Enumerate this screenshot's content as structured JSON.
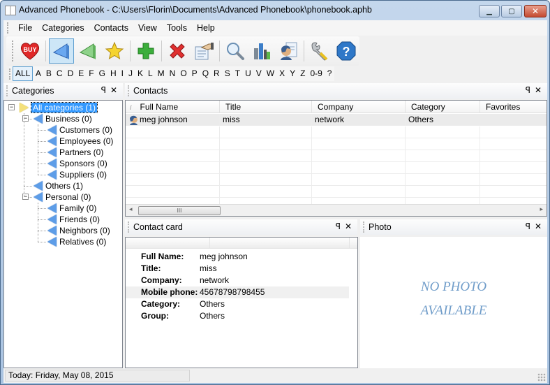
{
  "window": {
    "title": "Advanced Phonebook - C:\\Users\\Florin\\Documents\\Advanced Phonebook\\phonebook.aphb",
    "minimize": "▁",
    "maximize": "▢",
    "close": "✕"
  },
  "menu": [
    "File",
    "Categories",
    "Contacts",
    "View",
    "Tools",
    "Help"
  ],
  "toolbar": {
    "buttons": [
      {
        "name": "buy-button",
        "icon": "buy-heart-icon"
      },
      {
        "name": "back-button",
        "icon": "blue-triangle-icon",
        "active": true
      },
      {
        "name": "green-triangle-button",
        "icon": "green-triangle-icon"
      },
      {
        "name": "favorites-button",
        "icon": "star-icon"
      },
      {
        "name": "add-contact-button",
        "icon": "plus-icon"
      },
      {
        "name": "delete-contact-button",
        "icon": "x-icon"
      },
      {
        "name": "edit-contact-button",
        "icon": "hand-document-icon"
      },
      {
        "name": "search-button",
        "icon": "magnifier-icon"
      },
      {
        "name": "statistics-button",
        "icon": "bar-chart-icon"
      },
      {
        "name": "contact-card-button",
        "icon": "person-card-icon"
      },
      {
        "name": "settings-button",
        "icon": "wrench-icon"
      },
      {
        "name": "help-button",
        "icon": "help-icon"
      }
    ]
  },
  "alphabet": {
    "selected": "ALL",
    "items": [
      "ALL",
      "A",
      "B",
      "C",
      "D",
      "E",
      "F",
      "G",
      "H",
      "I",
      "J",
      "K",
      "L",
      "M",
      "N",
      "O",
      "P",
      "Q",
      "R",
      "S",
      "T",
      "U",
      "V",
      "W",
      "X",
      "Y",
      "Z",
      "0-9",
      "?"
    ]
  },
  "categories_panel": {
    "title": "Categories",
    "pin": "ꟼ",
    "close": "✕",
    "tree": [
      {
        "label": "All categories (1)",
        "level": 0,
        "selected": true,
        "expanded": true
      },
      {
        "label": "Business (0)",
        "level": 1,
        "expanded": true
      },
      {
        "label": "Customers (0)",
        "level": 2
      },
      {
        "label": "Employees (0)",
        "level": 2
      },
      {
        "label": "Partners (0)",
        "level": 2
      },
      {
        "label": "Sponsors (0)",
        "level": 2
      },
      {
        "label": "Suppliers (0)",
        "level": 2
      },
      {
        "label": "Others (1)",
        "level": 1
      },
      {
        "label": "Personal (0)",
        "level": 1,
        "expanded": true
      },
      {
        "label": "Family (0)",
        "level": 2
      },
      {
        "label": "Friends (0)",
        "level": 2
      },
      {
        "label": "Neighbors (0)",
        "level": 2
      },
      {
        "label": "Relatives (0)",
        "level": 2
      }
    ]
  },
  "contacts_panel": {
    "title": "Contacts",
    "sort_indicator": "/",
    "columns": [
      "Full Name",
      "Title",
      "Company",
      "Category",
      "Favorites"
    ],
    "rows": [
      {
        "full_name": "meg johnson",
        "title": "miss",
        "company": "network",
        "category": "Others",
        "favorites": ""
      }
    ],
    "scroll_thumb_label": "III",
    "scroll_left": "◂",
    "scroll_right": "▸"
  },
  "contact_card": {
    "title": "Contact card",
    "fields": [
      {
        "label": "Full Name:",
        "value": "meg johnson"
      },
      {
        "label": "Title:",
        "value": "miss"
      },
      {
        "label": "Company:",
        "value": "network"
      },
      {
        "label": "Mobile phone:",
        "value": "45678798798455"
      },
      {
        "label": "Category:",
        "value": "Others"
      },
      {
        "label": "Group:",
        "value": "Others"
      }
    ]
  },
  "photo_panel": {
    "title": "Photo",
    "placeholder_line1": "NO PHOTO",
    "placeholder_line2": "AVAILABLE"
  },
  "status": {
    "today": "Today: Friday, May 08, 2015"
  }
}
